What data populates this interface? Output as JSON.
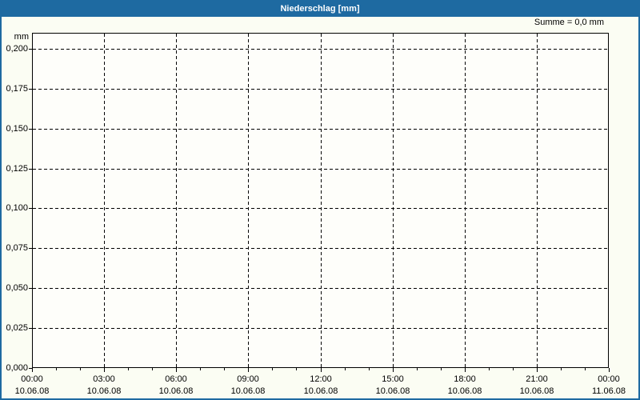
{
  "window": {
    "title": "Niederschlag [mm]"
  },
  "chart_data": {
    "type": "line",
    "title": "Niederschlag [mm]",
    "ylabel": "mm",
    "xlabel": "",
    "sum_annotation": "Summe = 0,0 mm",
    "grid": {
      "style": "dashed",
      "color": "#000000",
      "on": true
    },
    "legend_position": "none",
    "y_axis": {
      "range": [
        0,
        0.21
      ],
      "ticks": [
        {
          "label": "0,000",
          "value": 0.0
        },
        {
          "label": "0,025",
          "value": 0.025
        },
        {
          "label": "0,050",
          "value": 0.05
        },
        {
          "label": "0,075",
          "value": 0.075
        },
        {
          "label": "0,100",
          "value": 0.1
        },
        {
          "label": "0,125",
          "value": 0.125
        },
        {
          "label": "0,150",
          "value": 0.15
        },
        {
          "label": "0,175",
          "value": 0.175
        },
        {
          "label": "0,200",
          "value": 0.2
        }
      ]
    },
    "x_axis": {
      "hours_total": 24,
      "minor_tick_every_hours": 1,
      "major_tick_every_hours": 3,
      "major_ticks": [
        {
          "hour": 0,
          "time": "00:00",
          "date": "10.06.08"
        },
        {
          "hour": 3,
          "time": "03:00",
          "date": "10.06.08"
        },
        {
          "hour": 6,
          "time": "06:00",
          "date": "10.06.08"
        },
        {
          "hour": 9,
          "time": "09:00",
          "date": "10.06.08"
        },
        {
          "hour": 12,
          "time": "12:00",
          "date": "10.06.08"
        },
        {
          "hour": 15,
          "time": "15:00",
          "date": "10.06.08"
        },
        {
          "hour": 18,
          "time": "18:00",
          "date": "10.06.08"
        },
        {
          "hour": 21,
          "time": "21:00",
          "date": "10.06.08"
        },
        {
          "hour": 24,
          "time": "00:00",
          "date": "11.06.08"
        }
      ]
    },
    "series": [
      {
        "name": "Niederschlag",
        "unit": "mm",
        "sum": "0,0",
        "values": []
      }
    ]
  },
  "colors": {
    "titlebar": "#1e6aa1",
    "frame_border": "#1e6aa1",
    "background": "#fbfdf3",
    "plot_background": "#fefefa",
    "grid": "#000000",
    "title_text": "#ffffff",
    "label_text": "#000000"
  }
}
